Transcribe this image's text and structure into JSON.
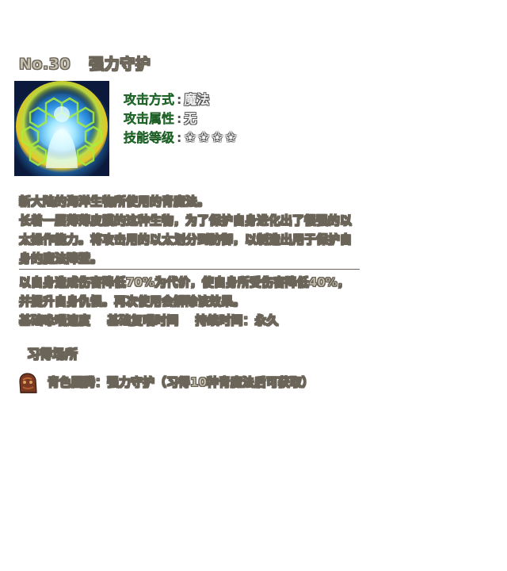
{
  "skill": {
    "number": "No.30",
    "name": "强力守护",
    "icon": "shield-aura-icon"
  },
  "meta": {
    "attack_type_label": "攻击方式",
    "attack_type_value": "魔法",
    "attack_attr_label": "攻击属性",
    "attack_attr_value": "无",
    "skill_level_label": "技能等级",
    "separator": ":",
    "star_rating": 4,
    "star_glyph": "✩"
  },
  "description": {
    "lines": [
      "新大陆的海洋生物所使用的青魔法。",
      "长着一层薄薄皮膜的这种生物，为了保护自身进化出了很强的以太操作能力。将攻击用的以太划分到防御，以制造出用于保护自身的魔法障壁。"
    ]
  },
  "effect": {
    "text": "以自身造成伤害降低70%为代价，使自身所受伤害降低40%，并提升自身仇恨。再次使用会解除该效果。"
  },
  "timing": {
    "cast": "基础咏唱速度",
    "recast": "基础复唱时间",
    "duration": "持续时间：永久"
  },
  "learn": {
    "header": "习得场所",
    "item_icon": "totem-icon",
    "text": "青色图腾：强力守护（习得10种青魔法后可获取）"
  },
  "colors": {
    "outlined_text": "#c6c0b0",
    "outline": "#6b6458",
    "label_green": "#2f9b3c",
    "value_white": "#f2f2f2"
  }
}
